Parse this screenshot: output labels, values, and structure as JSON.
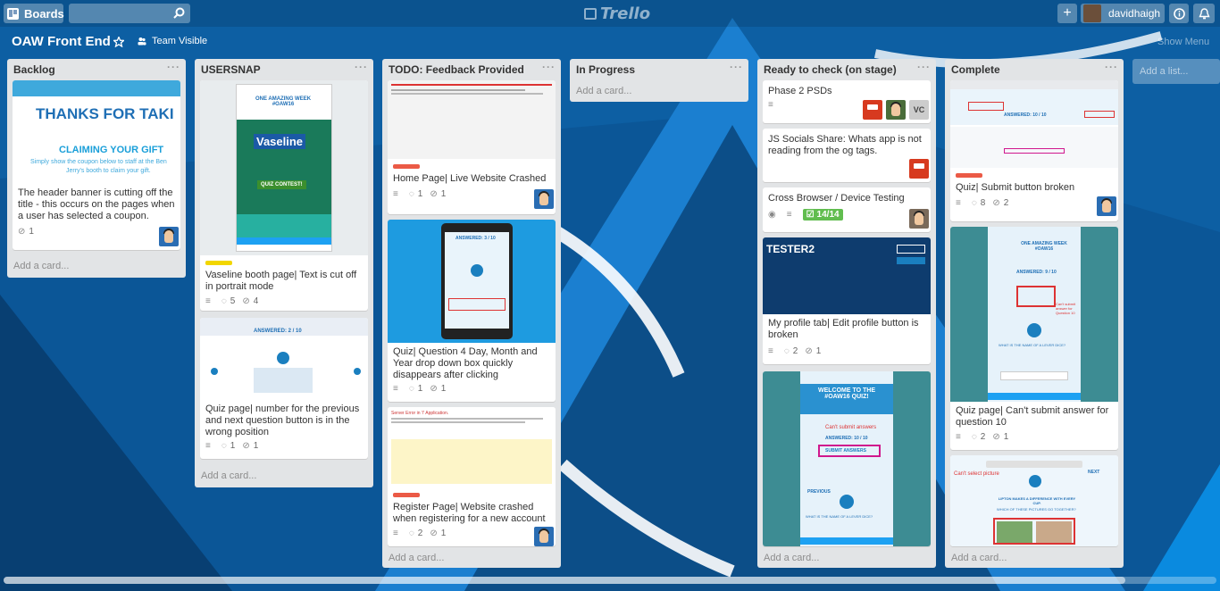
{
  "header": {
    "boards_label": "Boards",
    "search_placeholder": "",
    "logo_text": "Trello",
    "add_icon": "plus-icon",
    "username": "davidhaigh",
    "info_icon": "info-icon",
    "notifications_icon": "bell-icon"
  },
  "board": {
    "title": "OAW Front End",
    "visibility": "Team Visible",
    "show_menu": "Show Menu",
    "add_list": "Add a list..."
  },
  "add_card_label": "Add a card...",
  "colors": {
    "label_red": "#eb5a46",
    "label_yellow": "#f2d600",
    "checklist_green": "#61bd4f"
  },
  "lists": [
    {
      "name": "Backlog",
      "cards": [
        {
          "cover_text_1": "THANKS FOR TAKI",
          "cover_text_2": "CLAIMING YOUR GIFT",
          "cover_text_3": "Simply show the coupon below to staff at the Ben",
          "cover_text_4": "Jerry's booth to claim your gift.",
          "title": "The header banner is cutting off the title - this occurs on the pages when a user has selected a coupon.",
          "attachments": "1"
        }
      ]
    },
    {
      "name": "USERSNAP",
      "cards": [
        {
          "cover_text": "ONE AMAZING WEEK #OAW16",
          "cover_brand": "Vaseline",
          "cover_button": "QUIZ CONTEST!",
          "title": "Vaseline booth page| Text is cut off in portrait mode",
          "comments": "5",
          "attachments": "4"
        },
        {
          "cover_text": "ANSWERED: 2 / 10",
          "title": "Quiz page| number for the previous and next question button is in the wrong position",
          "comments": "1",
          "attachments": "1"
        }
      ]
    },
    {
      "name": "TODO: Feedback Provided",
      "cards": [
        {
          "title": "Home Page| Live Website Crashed",
          "comments": "1",
          "attachments": "1"
        },
        {
          "cover_text": "ANSWERED: 3 / 10",
          "title": "Quiz| Question 4 Day, Month and Year drop down box quickly disappears after clicking",
          "comments": "1",
          "attachments": "1"
        },
        {
          "cover_text": "Server Error in '/' Application.",
          "title": "Register Page| Website crashed when registering for a new account",
          "comments": "2",
          "attachments": "1"
        }
      ]
    },
    {
      "name": "In Progress",
      "cards": []
    },
    {
      "name": "Ready to check (on stage)",
      "cards": [
        {
          "title": "Phase 2 PSDs",
          "member_initials": "VC"
        },
        {
          "title": "JS Socials Share: Whats app is not reading from the og tags."
        },
        {
          "title": "Cross Browser / Device Testing",
          "checklist": "14/14"
        },
        {
          "cover_text": "TESTER2",
          "title": "My profile tab| Edit profile button is broken",
          "comments": "2",
          "attachments": "1"
        },
        {
          "cover_text_1": "WELCOME TO THE #OAW16 QUIZ!",
          "cover_text_2": "Can't submit answers",
          "cover_text_3": "ANSWERED: 10 / 10",
          "cover_text_4": "SUBMIT ANSWERS",
          "cover_text_5": "PREVIOUS",
          "cover_text_6": "WHAT IS THE NAME OF A LEVER DICE?"
        }
      ]
    },
    {
      "name": "Complete",
      "cards": [
        {
          "cover_text": "ANSWERED: 10 / 10",
          "title": "Quiz| Submit button broken",
          "comments": "8",
          "attachments": "2"
        },
        {
          "cover_text_1": "ONE AMAZING WEEK #OAW16",
          "cover_text_2": "ANSWERED: 9 / 10",
          "cover_text_3": "Can't submit answer for Question 10",
          "cover_text_4": "WHAT IS THE NAME OF A LEVER DICE?",
          "title": "Quiz page| Can't submit answer for question 10",
          "comments": "2",
          "attachments": "1"
        },
        {
          "cover_text_1": "Can't select picture",
          "cover_text_2": "NEXT",
          "cover_text_3": "LIPTON MAKES A DIFFERENCE WITH EVERY CUP.",
          "cover_text_4": "WHICH OF THESE PICTURES GO TOGETHER?"
        }
      ]
    }
  ]
}
